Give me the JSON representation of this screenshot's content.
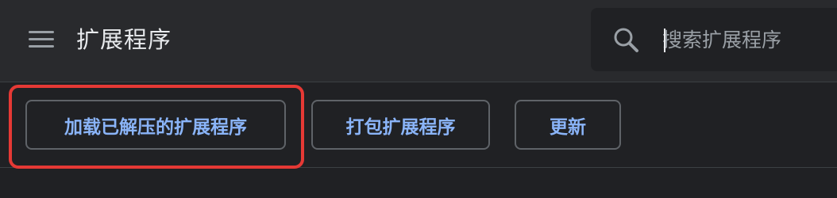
{
  "header": {
    "menu_icon": "hamburger-menu-icon",
    "title": "扩展程序"
  },
  "search": {
    "icon": "search-icon",
    "placeholder": "搜索扩展程序",
    "value": ""
  },
  "toolbar": {
    "load_unpacked_label": "加载已解压的扩展程序",
    "pack_label": "打包扩展程序",
    "update_label": "更新"
  },
  "colors": {
    "background": "#202124",
    "header_background": "#292a2d",
    "button_text": "#8ab4f8",
    "button_border": "#5f6368",
    "highlight": "#e53935",
    "title_text": "#e8eaed",
    "icon": "#9aa0a6"
  }
}
